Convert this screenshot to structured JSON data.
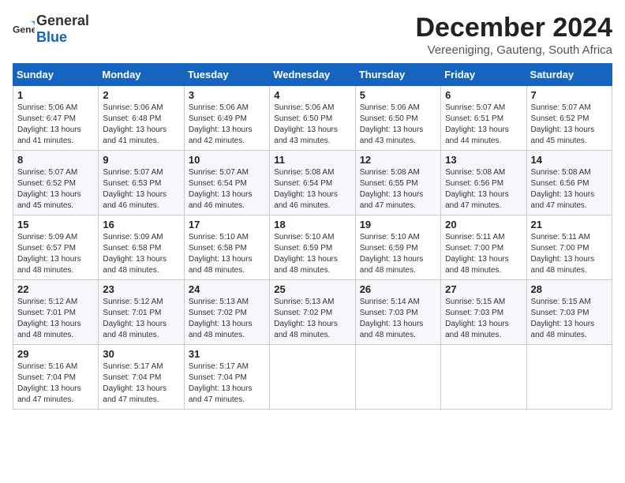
{
  "header": {
    "logo_general": "General",
    "logo_blue": "Blue",
    "month_title": "December 2024",
    "subtitle": "Vereeniging, Gauteng, South Africa"
  },
  "weekdays": [
    "Sunday",
    "Monday",
    "Tuesday",
    "Wednesday",
    "Thursday",
    "Friday",
    "Saturday"
  ],
  "weeks": [
    [
      {
        "day": "1",
        "sunrise": "5:06 AM",
        "sunset": "6:47 PM",
        "daylight": "13 hours and 41 minutes."
      },
      {
        "day": "2",
        "sunrise": "5:06 AM",
        "sunset": "6:48 PM",
        "daylight": "13 hours and 41 minutes."
      },
      {
        "day": "3",
        "sunrise": "5:06 AM",
        "sunset": "6:49 PM",
        "daylight": "13 hours and 42 minutes."
      },
      {
        "day": "4",
        "sunrise": "5:06 AM",
        "sunset": "6:50 PM",
        "daylight": "13 hours and 43 minutes."
      },
      {
        "day": "5",
        "sunrise": "5:06 AM",
        "sunset": "6:50 PM",
        "daylight": "13 hours and 43 minutes."
      },
      {
        "day": "6",
        "sunrise": "5:07 AM",
        "sunset": "6:51 PM",
        "daylight": "13 hours and 44 minutes."
      },
      {
        "day": "7",
        "sunrise": "5:07 AM",
        "sunset": "6:52 PM",
        "daylight": "13 hours and 45 minutes."
      }
    ],
    [
      {
        "day": "8",
        "sunrise": "5:07 AM",
        "sunset": "6:52 PM",
        "daylight": "13 hours and 45 minutes."
      },
      {
        "day": "9",
        "sunrise": "5:07 AM",
        "sunset": "6:53 PM",
        "daylight": "13 hours and 46 minutes."
      },
      {
        "day": "10",
        "sunrise": "5:07 AM",
        "sunset": "6:54 PM",
        "daylight": "13 hours and 46 minutes."
      },
      {
        "day": "11",
        "sunrise": "5:08 AM",
        "sunset": "6:54 PM",
        "daylight": "13 hours and 46 minutes."
      },
      {
        "day": "12",
        "sunrise": "5:08 AM",
        "sunset": "6:55 PM",
        "daylight": "13 hours and 47 minutes."
      },
      {
        "day": "13",
        "sunrise": "5:08 AM",
        "sunset": "6:56 PM",
        "daylight": "13 hours and 47 minutes."
      },
      {
        "day": "14",
        "sunrise": "5:08 AM",
        "sunset": "6:56 PM",
        "daylight": "13 hours and 47 minutes."
      }
    ],
    [
      {
        "day": "15",
        "sunrise": "5:09 AM",
        "sunset": "6:57 PM",
        "daylight": "13 hours and 48 minutes."
      },
      {
        "day": "16",
        "sunrise": "5:09 AM",
        "sunset": "6:58 PM",
        "daylight": "13 hours and 48 minutes."
      },
      {
        "day": "17",
        "sunrise": "5:10 AM",
        "sunset": "6:58 PM",
        "daylight": "13 hours and 48 minutes."
      },
      {
        "day": "18",
        "sunrise": "5:10 AM",
        "sunset": "6:59 PM",
        "daylight": "13 hours and 48 minutes."
      },
      {
        "day": "19",
        "sunrise": "5:10 AM",
        "sunset": "6:59 PM",
        "daylight": "13 hours and 48 minutes."
      },
      {
        "day": "20",
        "sunrise": "5:11 AM",
        "sunset": "7:00 PM",
        "daylight": "13 hours and 48 minutes."
      },
      {
        "day": "21",
        "sunrise": "5:11 AM",
        "sunset": "7:00 PM",
        "daylight": "13 hours and 48 minutes."
      }
    ],
    [
      {
        "day": "22",
        "sunrise": "5:12 AM",
        "sunset": "7:01 PM",
        "daylight": "13 hours and 48 minutes."
      },
      {
        "day": "23",
        "sunrise": "5:12 AM",
        "sunset": "7:01 PM",
        "daylight": "13 hours and 48 minutes."
      },
      {
        "day": "24",
        "sunrise": "5:13 AM",
        "sunset": "7:02 PM",
        "daylight": "13 hours and 48 minutes."
      },
      {
        "day": "25",
        "sunrise": "5:13 AM",
        "sunset": "7:02 PM",
        "daylight": "13 hours and 48 minutes."
      },
      {
        "day": "26",
        "sunrise": "5:14 AM",
        "sunset": "7:03 PM",
        "daylight": "13 hours and 48 minutes."
      },
      {
        "day": "27",
        "sunrise": "5:15 AM",
        "sunset": "7:03 PM",
        "daylight": "13 hours and 48 minutes."
      },
      {
        "day": "28",
        "sunrise": "5:15 AM",
        "sunset": "7:03 PM",
        "daylight": "13 hours and 48 minutes."
      }
    ],
    [
      {
        "day": "29",
        "sunrise": "5:16 AM",
        "sunset": "7:04 PM",
        "daylight": "13 hours and 47 minutes."
      },
      {
        "day": "30",
        "sunrise": "5:17 AM",
        "sunset": "7:04 PM",
        "daylight": "13 hours and 47 minutes."
      },
      {
        "day": "31",
        "sunrise": "5:17 AM",
        "sunset": "7:04 PM",
        "daylight": "13 hours and 47 minutes."
      },
      null,
      null,
      null,
      null
    ]
  ],
  "labels": {
    "sunrise": "Sunrise:",
    "sunset": "Sunset:",
    "daylight": "Daylight:"
  }
}
